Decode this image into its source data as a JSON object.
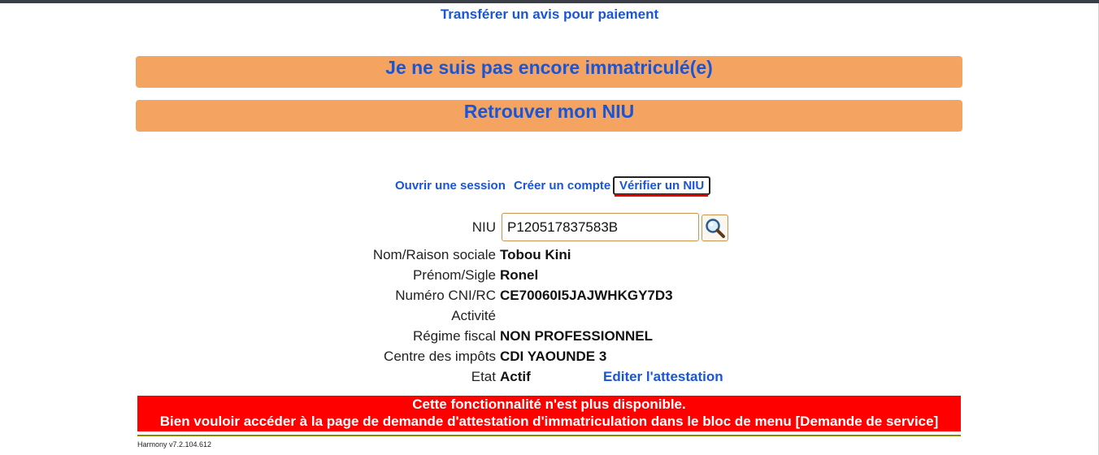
{
  "top_link": "Transférer un avis pour paiement",
  "buttons": {
    "not_registered": "Je ne suis pas encore immatriculé(e)",
    "find_niu": "Retrouver mon NIU"
  },
  "tabs": {
    "login": "Ouvrir une session",
    "create": "Créer un compte",
    "verify": "Vérifier un NIU"
  },
  "form": {
    "niu_label": "NIU",
    "niu_value": "P120517837583B",
    "fields": [
      {
        "label": "Nom/Raison sociale",
        "value": "Tobou Kini"
      },
      {
        "label": "Prénom/Sigle",
        "value": "Ronel"
      },
      {
        "label": "Numéro CNI/RC",
        "value": "CE70060I5JAJWHKGY7D3"
      },
      {
        "label": "Activité",
        "value": ""
      },
      {
        "label": "Régime fiscal",
        "value": "NON PROFESSIONNEL"
      },
      {
        "label": "Centre des impôts",
        "value": "CDI YAOUNDE 3"
      },
      {
        "label": "Etat",
        "value": "Actif"
      }
    ],
    "edit_link": "Editer l'attestation"
  },
  "alert": {
    "line1": "Cette fonctionnalité n'est plus disponible.",
    "line2": "Bien vouloir accéder à la page de demande d'attestation d'immatriculation dans le bloc de menu [Demande de service]"
  },
  "footer": "Harmony v7.2.104.612",
  "colors": {
    "link": "#1a55d6",
    "orange": "#f4a460",
    "alert": "#ff0000"
  }
}
